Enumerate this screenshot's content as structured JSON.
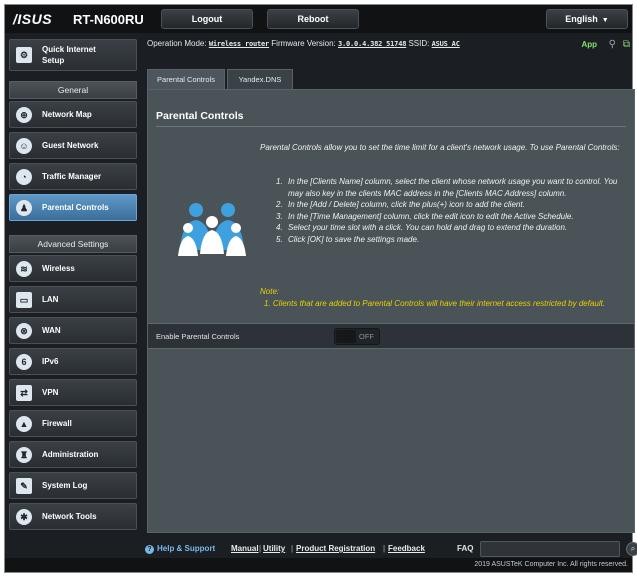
{
  "header": {
    "brand": "/ISUS",
    "model": "RT-N600RU",
    "logout_label": "Logout",
    "reboot_label": "Reboot",
    "language": "English"
  },
  "sidebar": {
    "quick_setup_line1": "Quick Internet",
    "quick_setup_line2": "Setup",
    "general_heading": "General",
    "general_items": [
      {
        "label": "Network Map",
        "icon": "network-map-icon"
      },
      {
        "label": "Guest Network",
        "icon": "guest-network-icon"
      },
      {
        "label": "Traffic Manager",
        "icon": "traffic-manager-icon"
      },
      {
        "label": "Parental Controls",
        "icon": "parental-controls-icon",
        "active": true
      }
    ],
    "advanced_heading": "Advanced Settings",
    "advanced_items": [
      {
        "label": "Wireless",
        "icon": "wireless-icon"
      },
      {
        "label": "LAN",
        "icon": "lan-icon"
      },
      {
        "label": "WAN",
        "icon": "wan-icon"
      },
      {
        "label": "IPv6",
        "icon": "ipv6-icon"
      },
      {
        "label": "VPN",
        "icon": "vpn-icon"
      },
      {
        "label": "Firewall",
        "icon": "firewall-icon"
      },
      {
        "label": "Administration",
        "icon": "administration-icon"
      },
      {
        "label": "System Log",
        "icon": "system-log-icon"
      },
      {
        "label": "Network Tools",
        "icon": "network-tools-icon"
      }
    ]
  },
  "status": {
    "op_mode_label": "Operation Mode:",
    "op_mode_value": "Wireless router",
    "firmware_label": "Firmware Version:",
    "firmware_value": "3.0.0.4.382_51748",
    "ssid_label": "SSID:",
    "ssid_value": "ASUS_AC",
    "app_label": "App"
  },
  "tabs": [
    {
      "label": "Parental Controls",
      "active": true
    },
    {
      "label": "Yandex.DNS",
      "active": false
    }
  ],
  "main": {
    "title": "Parental Controls",
    "intro": "Parental Controls allow you to set the time limit for a client's network usage. To use Parental Controls:",
    "steps": [
      {
        "num": "1.",
        "text": "In the [Clients Name] column, select the client whose network usage you want to control. You may also key in the clients MAC address in the [Clients MAC Address] column."
      },
      {
        "num": "2.",
        "text": "In the [Add / Delete] column, click the plus(+) icon to add the client."
      },
      {
        "num": "3.",
        "text": "In the [Time Management] column, click the edit icon to edit the Active Schedule."
      },
      {
        "num": "4.",
        "text": "Select your time slot with a click. You can hold and drag to extend the duration."
      },
      {
        "num": "5.",
        "text": "Click [OK] to save the settings made."
      }
    ],
    "note_heading": "Note:",
    "note_text": "1.  Clients that are added to Parental Controls will have their internet access restricted by default.",
    "enable_label": "Enable Parental Controls",
    "toggle_state": "OFF"
  },
  "footer": {
    "help_label": "Help & Support",
    "manual": "Manual",
    "utility": "Utility",
    "product_registration": "Product Registration",
    "feedback": "Feedback",
    "sep": "|",
    "faq_label": "FAQ",
    "copyright": "2019 ASUSTeK Computer Inc. All rights reserved."
  },
  "colors": {
    "active_tab": "#4d565d",
    "active_sidebar": "#5f98c8",
    "note_yellow": "#e8d100",
    "app_green": "#7fe46a"
  }
}
